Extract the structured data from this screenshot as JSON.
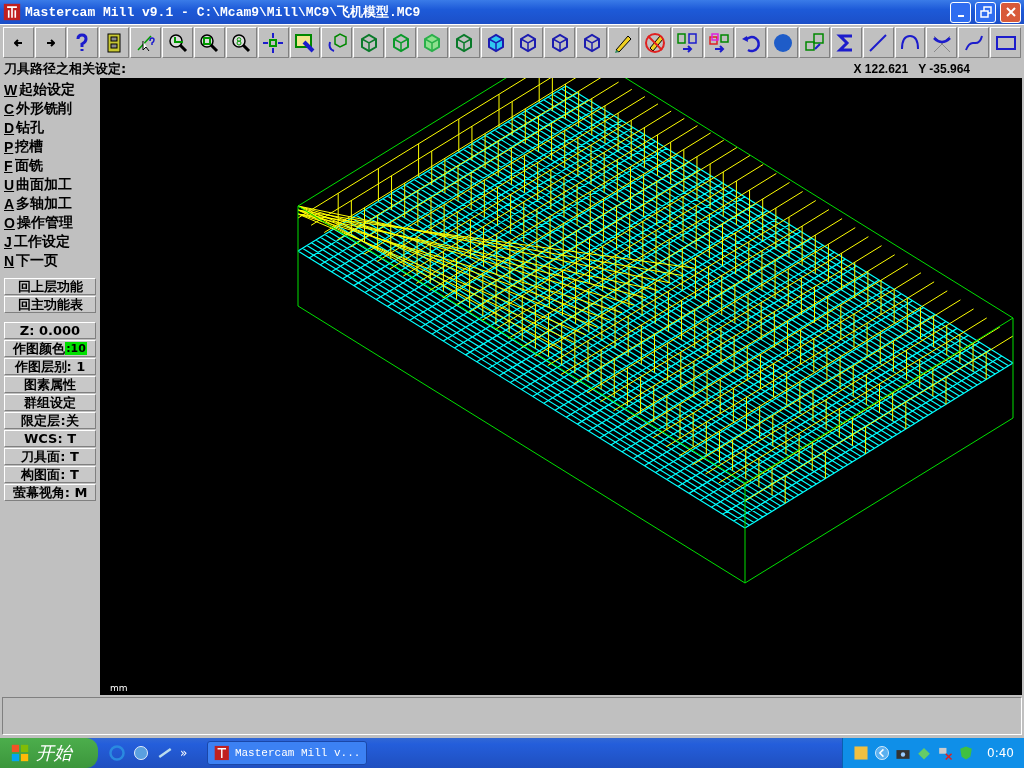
{
  "window": {
    "title": "Mastercam Mill v9.1 - C:\\Mcam9\\Mill\\MC9\\飞机模型.MC9"
  },
  "prompt": "刀具路径之相关设定:",
  "coordinates": {
    "x": "X 122.621",
    "y": "Y -35.964"
  },
  "menu": [
    {
      "key": "W",
      "label": "起始设定"
    },
    {
      "key": "C",
      "label": "外形铣削"
    },
    {
      "key": "D",
      "label": "钻孔"
    },
    {
      "key": "P",
      "label": "挖槽"
    },
    {
      "key": "F",
      "label": "面铣"
    },
    {
      "key": "U",
      "label": "曲面加工"
    },
    {
      "key": "A",
      "label": "多轴加工"
    },
    {
      "key": "O",
      "label": "操作管理"
    },
    {
      "key": "J",
      "label": "工作设定"
    },
    {
      "key": "N",
      "label": "下一页"
    }
  ],
  "nav_buttons": [
    "回上层功能",
    "回主功能表"
  ],
  "settings": [
    {
      "kind": "plain",
      "label": "Z:  0.000"
    },
    {
      "kind": "color",
      "label": "作图颜色",
      "value": ":10",
      "color": "#00e000"
    },
    {
      "kind": "plain",
      "label": "作图层别: 1"
    },
    {
      "kind": "plain",
      "label": "图素属性"
    },
    {
      "kind": "plain",
      "label": "群组设定"
    },
    {
      "kind": "plain",
      "label": "限定层:关"
    },
    {
      "kind": "plain",
      "label": "WCS:  T"
    },
    {
      "kind": "plain",
      "label": "刀具面: T"
    },
    {
      "kind": "plain",
      "label": "构图面: T"
    },
    {
      "kind": "plain",
      "label": "萤幕视角: M"
    }
  ],
  "viewport": {
    "unit": "mm"
  },
  "taskbar": {
    "start": "开始",
    "overflow": "»",
    "task": "Mastercam Mill v...",
    "clock": "0:40"
  }
}
